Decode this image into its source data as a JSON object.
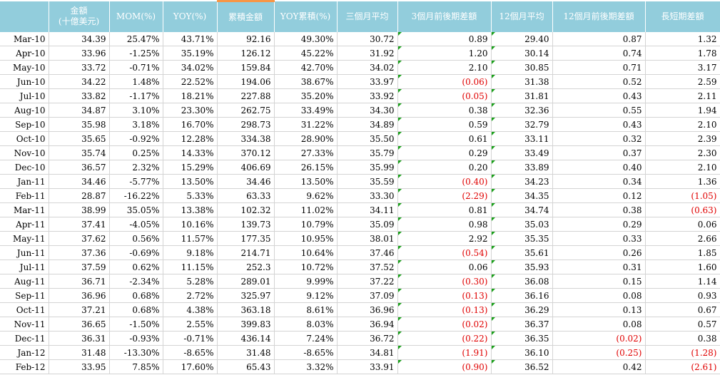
{
  "header": {
    "columns": [
      "",
      "金額\n(十億美元)",
      "MOM(%)",
      "YOY(%)",
      "累積金額",
      "YOY累積(%)",
      "三個月平均",
      "3個月前後期差額",
      "12個月平均",
      "12個月前後期差額",
      "長短期差額"
    ]
  },
  "rows": [
    [
      "Mar-10",
      "34.39",
      "25.47%",
      "43.71%",
      "92.16",
      "49.30%",
      "30.72",
      "0.89",
      "29.40",
      "0.87",
      "1.32"
    ],
    [
      "Apr-10",
      "33.96",
      "-1.25%",
      "35.19%",
      "126.12",
      "45.22%",
      "31.92",
      "1.20",
      "30.14",
      "0.74",
      "1.78"
    ],
    [
      "May-10",
      "33.72",
      "-0.71%",
      "34.02%",
      "159.84",
      "42.70%",
      "34.02",
      "2.10",
      "30.85",
      "0.71",
      "3.17"
    ],
    [
      "Jun-10",
      "34.22",
      "1.48%",
      "22.52%",
      "194.06",
      "38.67%",
      "33.97",
      "(0.06)",
      "31.38",
      "0.52",
      "2.59"
    ],
    [
      "Jul-10",
      "33.82",
      "-1.17%",
      "18.21%",
      "227.88",
      "35.20%",
      "33.92",
      "(0.05)",
      "31.81",
      "0.43",
      "2.11"
    ],
    [
      "Aug-10",
      "34.87",
      "3.10%",
      "23.30%",
      "262.75",
      "33.49%",
      "34.30",
      "0.38",
      "32.36",
      "0.55",
      "1.94"
    ],
    [
      "Sep-10",
      "35.98",
      "3.18%",
      "16.70%",
      "298.73",
      "31.22%",
      "34.89",
      "0.59",
      "32.79",
      "0.43",
      "2.10"
    ],
    [
      "Oct-10",
      "35.65",
      "-0.92%",
      "12.28%",
      "334.38",
      "28.90%",
      "35.50",
      "0.61",
      "33.11",
      "0.32",
      "2.39"
    ],
    [
      "Nov-10",
      "35.74",
      "0.25%",
      "14.33%",
      "370.12",
      "27.33%",
      "35.79",
      "0.29",
      "33.49",
      "0.37",
      "2.30"
    ],
    [
      "Dec-10",
      "36.57",
      "2.32%",
      "15.29%",
      "406.69",
      "26.15%",
      "35.99",
      "0.20",
      "33.89",
      "0.40",
      "2.10"
    ],
    [
      "Jan-11",
      "34.46",
      "-5.77%",
      "13.50%",
      "34.46",
      "13.50%",
      "35.59",
      "(0.40)",
      "34.23",
      "0.34",
      "1.36"
    ],
    [
      "Feb-11",
      "28.87",
      "-16.22%",
      "5.33%",
      "63.33",
      "9.62%",
      "33.30",
      "(2.29)",
      "34.35",
      "0.12",
      "(1.05)"
    ],
    [
      "Mar-11",
      "38.99",
      "35.05%",
      "13.38%",
      "102.32",
      "11.02%",
      "34.11",
      "0.81",
      "34.74",
      "0.38",
      "(0.63)"
    ],
    [
      "Apr-11",
      "37.41",
      "-4.05%",
      "10.16%",
      "139.73",
      "10.79%",
      "35.09",
      "0.98",
      "35.03",
      "0.29",
      "0.06"
    ],
    [
      "May-11",
      "37.62",
      "0.56%",
      "11.57%",
      "177.35",
      "10.95%",
      "38.01",
      "2.92",
      "35.35",
      "0.33",
      "2.66"
    ],
    [
      "Jun-11",
      "37.36",
      "-0.69%",
      "9.18%",
      "214.71",
      "10.64%",
      "37.46",
      "(0.54)",
      "35.61",
      "0.26",
      "1.85"
    ],
    [
      "Jul-11",
      "37.59",
      "0.62%",
      "11.15%",
      "252.3",
      "10.72%",
      "37.52",
      "0.06",
      "35.93",
      "0.31",
      "1.60"
    ],
    [
      "Aug-11",
      "36.71",
      "-2.34%",
      "5.28%",
      "289.01",
      "9.99%",
      "37.22",
      "(0.30)",
      "36.08",
      "0.15",
      "1.14"
    ],
    [
      "Sep-11",
      "36.96",
      "0.68%",
      "2.72%",
      "325.97",
      "9.12%",
      "37.09",
      "(0.13)",
      "36.16",
      "0.08",
      "0.93"
    ],
    [
      "Oct-11",
      "37.21",
      "0.68%",
      "4.38%",
      "363.18",
      "8.61%",
      "36.96",
      "(0.13)",
      "36.29",
      "0.13",
      "0.67"
    ],
    [
      "Nov-11",
      "36.65",
      "-1.50%",
      "2.55%",
      "399.83",
      "8.03%",
      "36.94",
      "(0.02)",
      "36.37",
      "0.08",
      "0.57"
    ],
    [
      "Dec-11",
      "36.31",
      "-0.93%",
      "-0.71%",
      "436.14",
      "7.24%",
      "36.72",
      "(0.22)",
      "36.35",
      "(0.02)",
      "0.38"
    ],
    [
      "Jan-12",
      "31.48",
      "-13.30%",
      "-8.65%",
      "31.48",
      "-8.65%",
      "34.81",
      "(1.91)",
      "36.10",
      "(0.25)",
      "(1.28)"
    ],
    [
      "Feb-12",
      "33.95",
      "7.85%",
      "17.60%",
      "65.43",
      "3.32%",
      "33.91",
      "(0.90)",
      "36.52",
      "0.42",
      "(2.61)"
    ]
  ],
  "colors": {
    "header_bg": "#92cddc",
    "header_text": "#ffffff",
    "header_accent": "#f79646",
    "negative": "#e00000",
    "comment_marker": "#1aa01a"
  }
}
